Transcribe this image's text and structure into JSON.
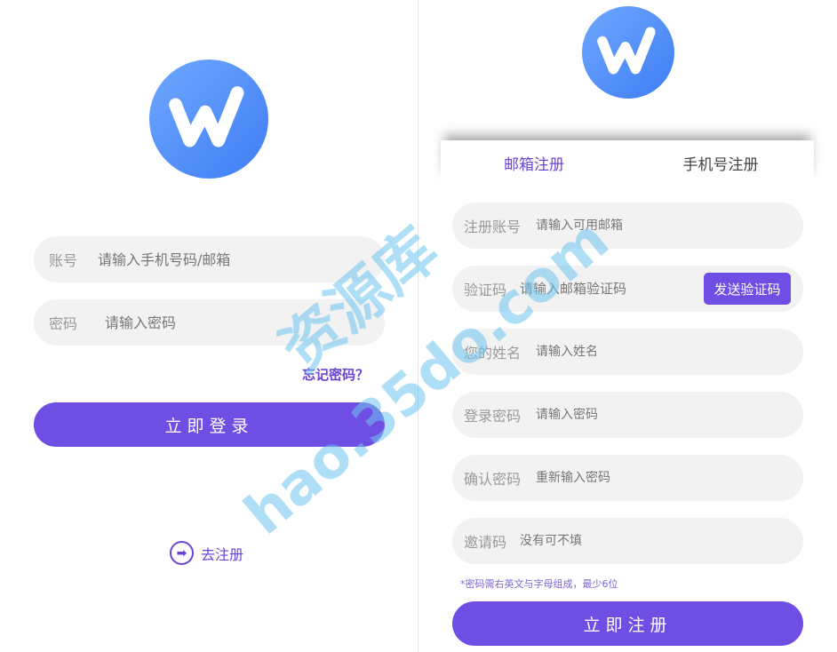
{
  "login": {
    "account_label": "账号",
    "account_placeholder": "请输入手机号码/邮箱",
    "password_label": "密码",
    "password_placeholder": "请输入密码",
    "forgot_label": "忘记密码？",
    "login_button": "立即登录",
    "goto_register": "去注册",
    "arrow_glyph": "➡"
  },
  "register": {
    "tabs": [
      {
        "label": "邮箱注册",
        "active": true
      },
      {
        "label": "手机号注册",
        "active": false
      }
    ],
    "fields": {
      "account_label": "注册账号",
      "account_placeholder": "请输入可用邮箱",
      "code_label": "验证码",
      "code_placeholder": "请输入邮箱验证码",
      "send_code_button": "发送验证码",
      "name_label": "您的姓名",
      "name_placeholder": "请输入姓名",
      "password_label": "登录密码",
      "password_placeholder": "请输入密码",
      "confirm_label": "确认密码",
      "confirm_placeholder": "重新输入密码",
      "invite_label": "邀请码",
      "invite_placeholder": "没有可不填"
    },
    "hint": "*密码需右英文与字母组成，最少6位",
    "submit_button": "立即注册"
  },
  "watermark": {
    "line1": "资源库",
    "line2": "hao.35do.com"
  },
  "colors": {
    "primary": "#6f4fe3",
    "accent_text": "#6a44d8",
    "logo_light": "#6fa8ff",
    "logo_dark": "#3f7df4",
    "field_bg": "#f2f2f2"
  },
  "icons": {
    "logo": "w-logo-icon",
    "goto_register": "arrow-right-circle-icon"
  }
}
